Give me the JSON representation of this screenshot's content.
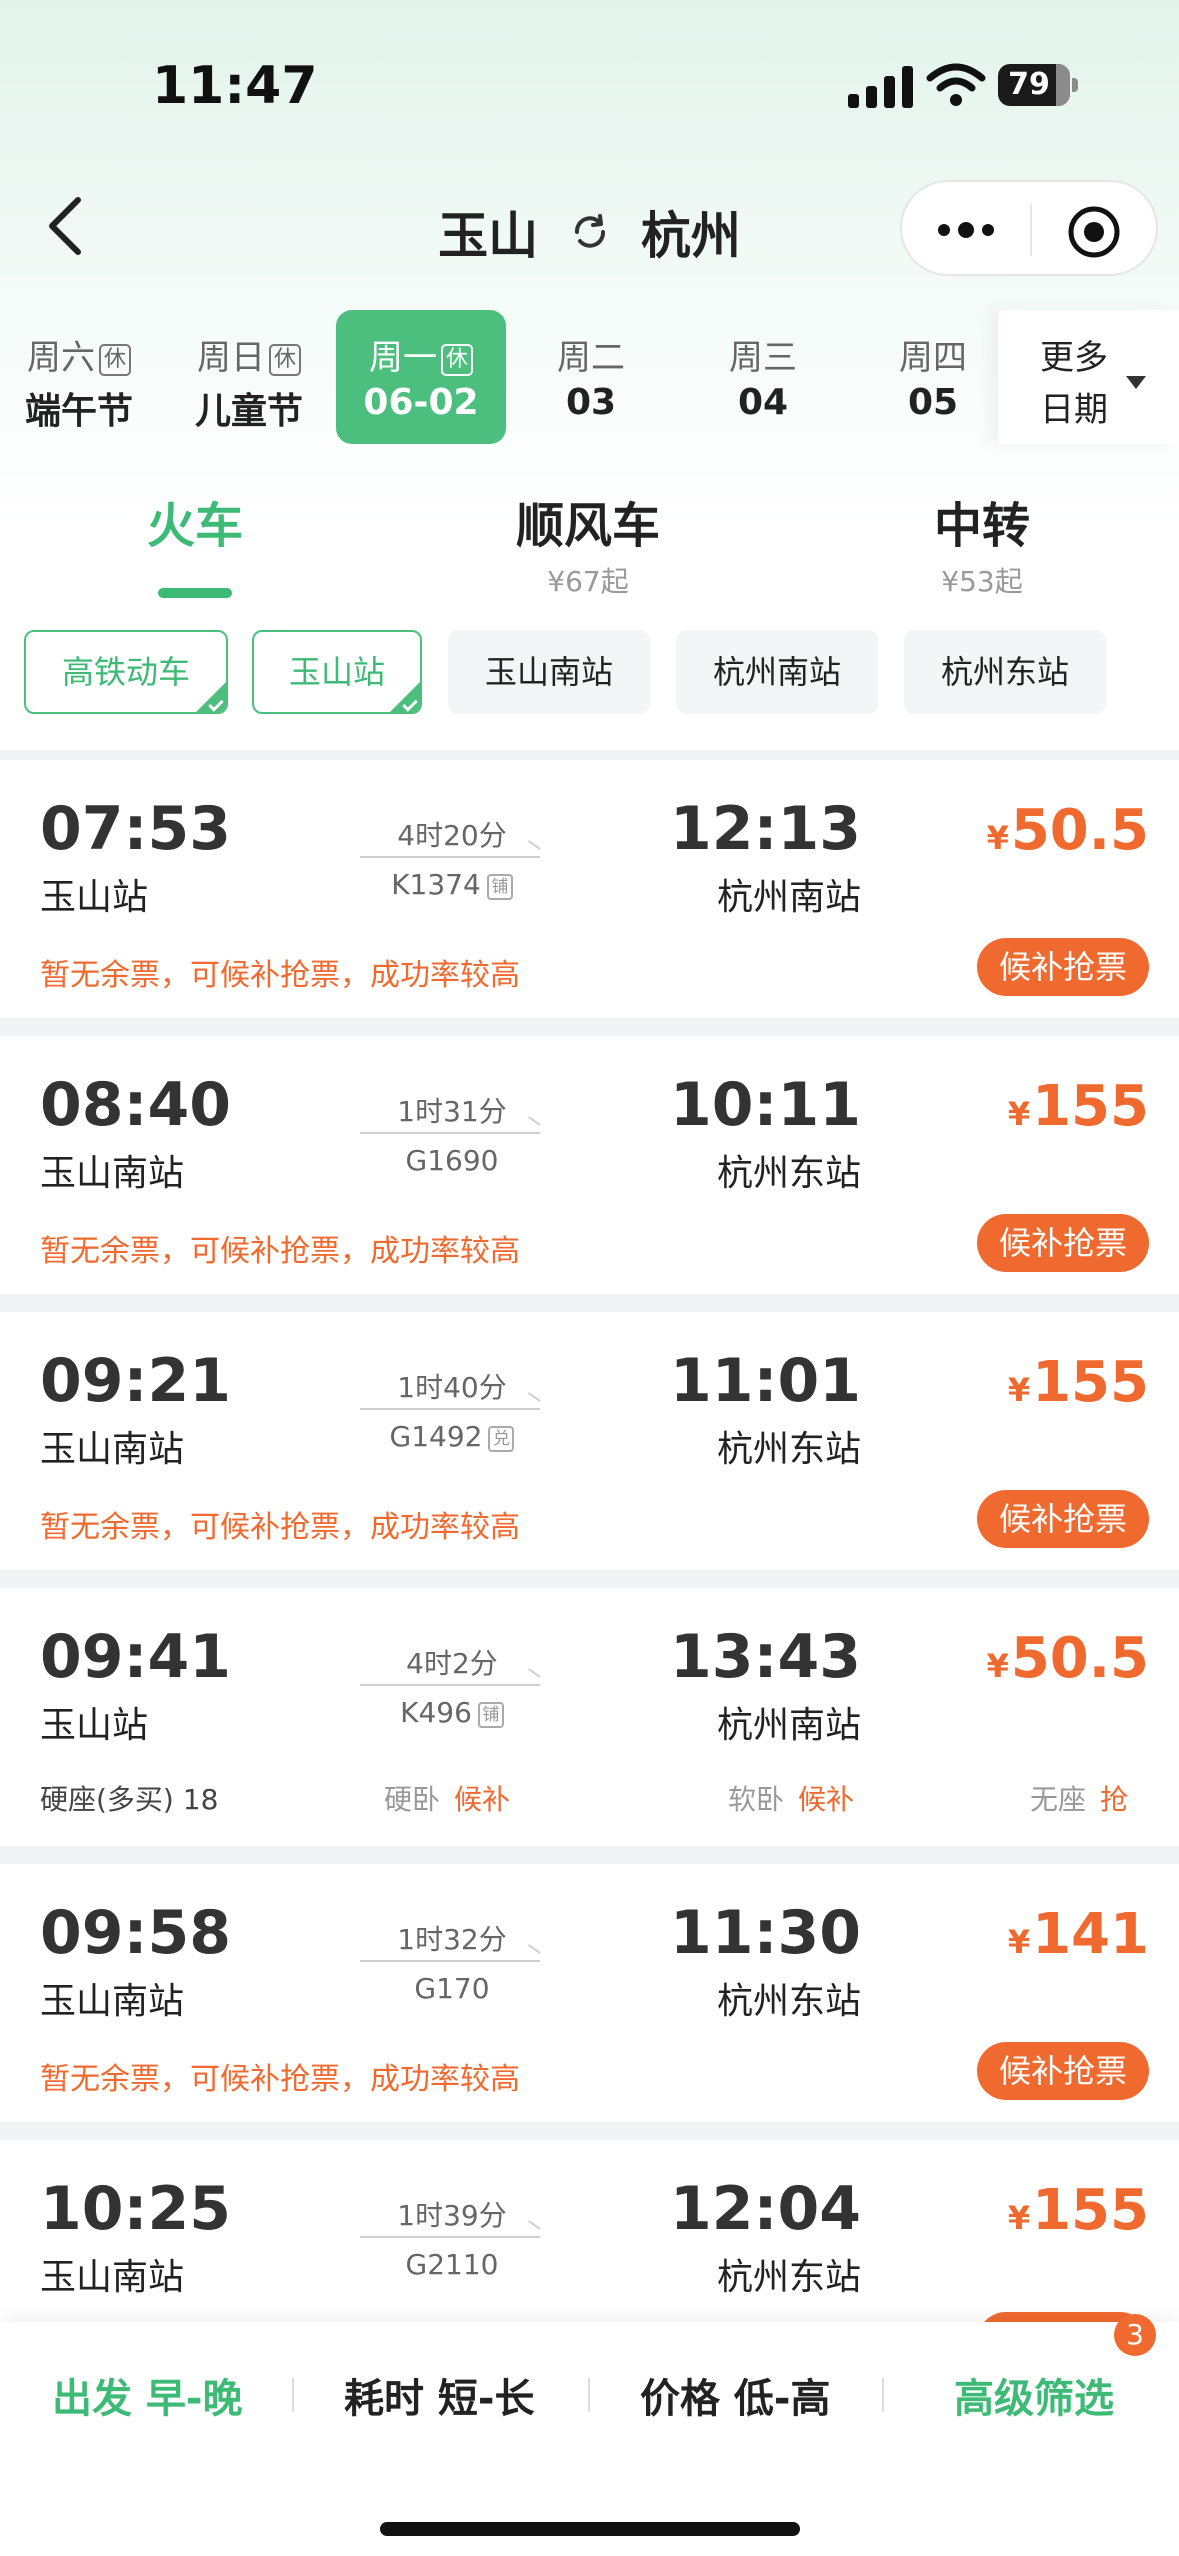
{
  "status_bar": {
    "time": "11:47",
    "battery": "79"
  },
  "nav": {
    "from": "玉山",
    "to": "杭州"
  },
  "dates": [
    {
      "weekday": "周六",
      "rest": "休",
      "label": "端午节",
      "active": false
    },
    {
      "weekday": "周日",
      "rest": "休",
      "label": "儿童节",
      "active": false
    },
    {
      "weekday": "周一",
      "rest": "休",
      "label": "06-02",
      "active": true
    },
    {
      "weekday": "周二",
      "rest": "",
      "label": "03",
      "active": false
    },
    {
      "weekday": "周三",
      "rest": "",
      "label": "04",
      "active": false
    },
    {
      "weekday": "周四",
      "rest": "",
      "label": "05",
      "active": false
    }
  ],
  "more_dates": {
    "line1": "更多",
    "line2": "日期"
  },
  "modes": [
    {
      "name": "火车",
      "sub": ""
    },
    {
      "name": "顺风车",
      "sub": "¥67起"
    },
    {
      "name": "中转",
      "sub": "¥53起"
    }
  ],
  "filters": [
    {
      "label": "高铁动车",
      "active": true
    },
    {
      "label": "玉山站",
      "active": true
    },
    {
      "label": "玉山南站",
      "active": false
    },
    {
      "label": "杭州南站",
      "active": false
    },
    {
      "label": "杭州东站",
      "active": false
    }
  ],
  "trains": [
    {
      "dep_time": "07:53",
      "dep_station": "玉山站",
      "duration": "4时20分",
      "train_no": "K1374",
      "badge": "铺",
      "arr_time": "12:13",
      "arr_station": "杭州南站",
      "currency": "¥",
      "price": "50.5",
      "note": "暂无余票，可候补抢票，成功率较高",
      "button": "候补抢票"
    },
    {
      "dep_time": "08:40",
      "dep_station": "玉山南站",
      "duration": "1时31分",
      "train_no": "G1690",
      "badge": "",
      "arr_time": "10:11",
      "arr_station": "杭州东站",
      "currency": "¥",
      "price": "155",
      "note": "暂无余票，可候补抢票，成功率较高",
      "button": "候补抢票"
    },
    {
      "dep_time": "09:21",
      "dep_station": "玉山南站",
      "duration": "1时40分",
      "train_no": "G1492",
      "badge": "兑",
      "arr_time": "11:01",
      "arr_station": "杭州东站",
      "currency": "¥",
      "price": "155",
      "note": "暂无余票，可候补抢票，成功率较高",
      "button": "候补抢票"
    },
    {
      "dep_time": "09:41",
      "dep_station": "玉山站",
      "duration": "4时2分",
      "train_no": "K496",
      "badge": "铺",
      "arr_time": "13:43",
      "arr_station": "杭州南站",
      "currency": "¥",
      "price": "50.5",
      "seats": {
        "s1": "硬座(多买) 18",
        "s2_name": "硬卧",
        "s2_status": "候补",
        "s3_name": "软卧",
        "s3_status": "候补",
        "s4_name": "无座",
        "s4_status": "抢"
      }
    },
    {
      "dep_time": "09:58",
      "dep_station": "玉山南站",
      "duration": "1时32分",
      "train_no": "G170",
      "badge": "",
      "arr_time": "11:30",
      "arr_station": "杭州东站",
      "currency": "¥",
      "price": "141",
      "note": "暂无余票，可候补抢票，成功率较高",
      "button": "候补抢票"
    },
    {
      "dep_time": "10:25",
      "dep_station": "玉山南站",
      "duration": "1时39分",
      "train_no": "G2110",
      "badge": "",
      "arr_time": "12:04",
      "arr_station": "杭州东站",
      "currency": "¥",
      "price": "155"
    }
  ],
  "bottom": {
    "depart": "出发 早-晚",
    "duration": "耗时 短-长",
    "price": "价格 低-高",
    "advanced": "高级筛选",
    "filter_count": "3"
  },
  "colors": {
    "green": "#3dba75",
    "orange": "#f06a2f"
  }
}
